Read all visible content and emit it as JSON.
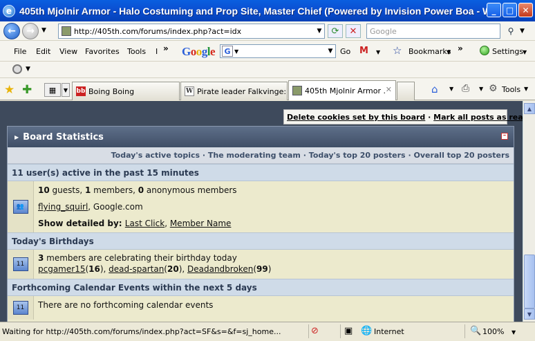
{
  "window": {
    "title": "405th Mjolnir Armor - Halo Costuming and Prop Site, Master Chief (Powered by Invision Power Boa - Windo...",
    "app_icon_letter": "e"
  },
  "addressbar": {
    "url": "http://405th.com/forums/index.php?act=idx",
    "search_placeholder": "Google"
  },
  "menubar": {
    "items": [
      "File",
      "Edit",
      "View",
      "Favorites",
      "Tools",
      "I"
    ],
    "google_go": "Go",
    "bookmarks": "Bookmarks",
    "settings": "Settings"
  },
  "tabs": {
    "items": [
      {
        "label": "Boing Boing",
        "icon": "bb"
      },
      {
        "label": "Pirate leader Falkvinge: ...",
        "icon": "wiki"
      },
      {
        "label": "405th Mjolnir Armor ...",
        "icon": "halo",
        "active": true
      }
    ],
    "tools": "Tools"
  },
  "page": {
    "cookie_link": "Delete cookies set by this board",
    "separator": "·",
    "mark_read_link": "Mark all posts as read",
    "board_stats_title": "Board Statistics",
    "links": {
      "active_topics": "Today's active topics",
      "moderating_team": "The moderating team",
      "top20_today": "Today's top 20 posters",
      "top20_overall": "Overall top 20 posters"
    },
    "active_users": {
      "header": "11 user(s) active in the past 15 minutes",
      "guests_count": "10",
      "guests_label": " guests, ",
      "members_count": "1",
      "members_label": " members, ",
      "anon_count": "0",
      "anon_label": " anonymous members",
      "user1": "flying_squirl",
      "user2": ", Google.com",
      "detail_label": "Show detailed by: ",
      "detail_last_click": "Last Click",
      "detail_comma": ", ",
      "detail_member_name": "Member Name"
    },
    "birthdays": {
      "header": "Today's Birthdays",
      "count": "3",
      "text": " members are celebrating their birthday today",
      "people": [
        {
          "name": "pcgamer15",
          "age": "16"
        },
        {
          "name": "dead-spartan",
          "age": "20"
        },
        {
          "name": "Deadandbroken",
          "age": "99"
        }
      ]
    },
    "calendar": {
      "header": "Forthcoming Calendar Events within the next 5 days",
      "text": "There are no forthcoming calendar events"
    }
  },
  "statusbar": {
    "text": "Waiting for http://405th.com/forums/index.php?act=SF&s=&f=sj_home...",
    "zone": "Internet",
    "zoom": "100%"
  }
}
